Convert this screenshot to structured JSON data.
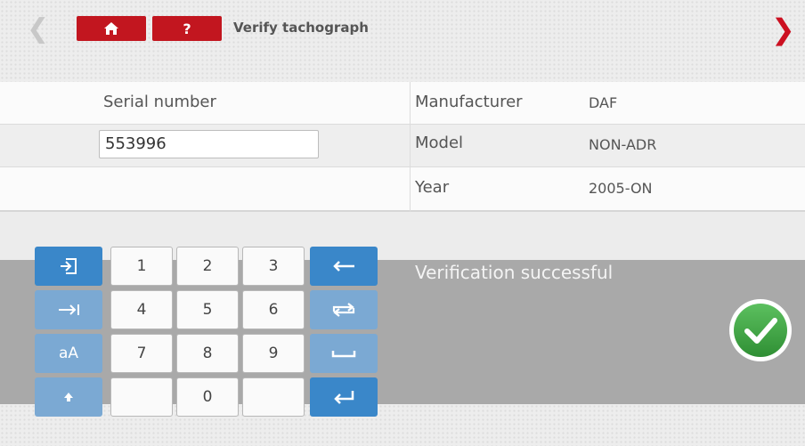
{
  "header": {
    "title": "Verify tachograph",
    "back_icon": "chevron-left-icon",
    "forward_icon": "chevron-right-icon",
    "home_icon": "home-icon",
    "help_label": "?"
  },
  "device": {
    "serial_label": "Serial number",
    "serial_value": "553996",
    "fields": [
      {
        "label": "Manufacturer",
        "value": "DAF"
      },
      {
        "label": "Model",
        "value": "NON-ADR"
      },
      {
        "label": "Year",
        "value": "2005-ON"
      }
    ]
  },
  "keypad": {
    "digits": [
      "1",
      "2",
      "3",
      "4",
      "5",
      "6",
      "7",
      "8",
      "9",
      "",
      "0",
      ""
    ],
    "left_keys": [
      {
        "name": "exit-key",
        "icon": "exit-icon"
      },
      {
        "name": "tab-key",
        "icon": "tab-arrow-icon"
      },
      {
        "name": "case-key",
        "label": "aA"
      },
      {
        "name": "shift-key",
        "icon": "shift-arrow-icon"
      }
    ],
    "right_keys": [
      {
        "name": "backspace-key",
        "icon": "backspace-arrow-icon"
      },
      {
        "name": "swap-key",
        "icon": "swap-arrows-icon"
      },
      {
        "name": "space-key",
        "icon": "space-bar-icon"
      },
      {
        "name": "enter-key",
        "icon": "enter-arrow-icon"
      }
    ]
  },
  "status": {
    "message": "Verification successful",
    "icon": "check-circle-icon",
    "accent_color": "#3a9a3f"
  },
  "colors": {
    "brand_red": "#c2161f",
    "key_blue": "#3a87c9",
    "panel_gray": "#a9a9a9"
  }
}
